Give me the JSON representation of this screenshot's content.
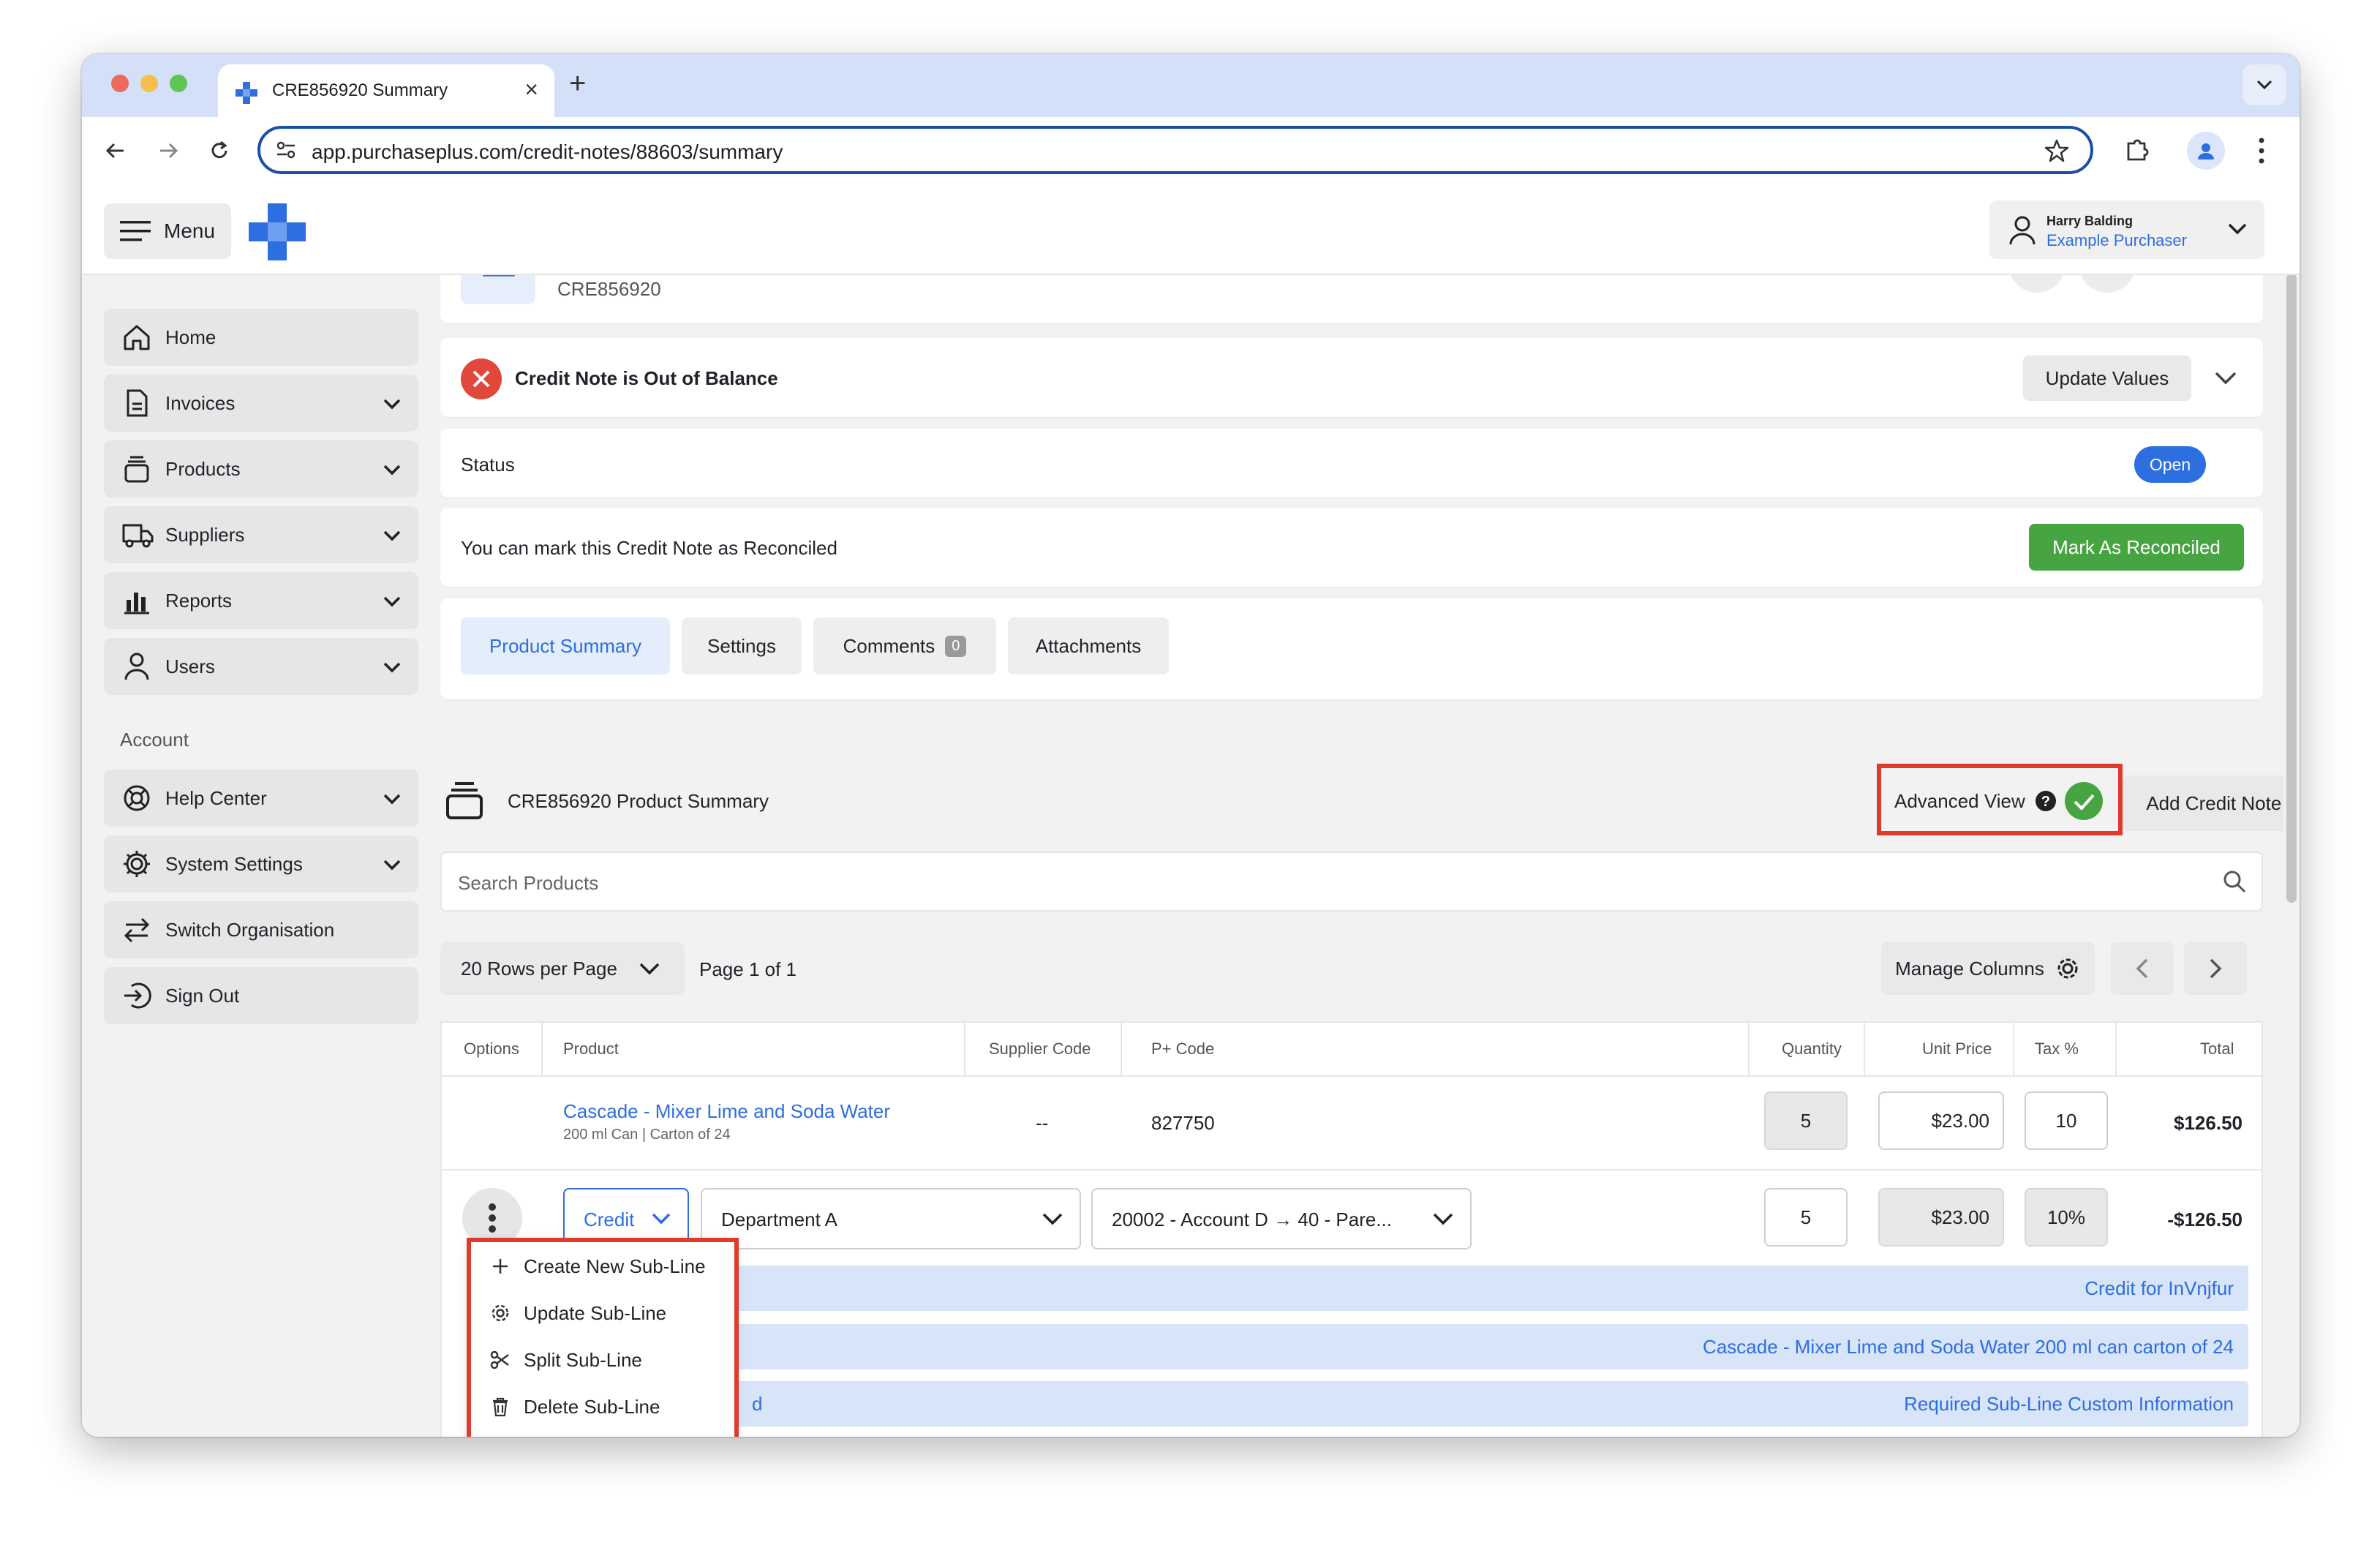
{
  "browser": {
    "tab_title": "CRE856920 Summary",
    "url": "app.purchaseplus.com/credit-notes/88603/summary"
  },
  "topbar": {
    "menu_label": "Menu",
    "user_name": "Harry Balding",
    "user_role": "Example Purchaser"
  },
  "sidebar": {
    "items": [
      {
        "label": "Home",
        "icon": "home-icon"
      },
      {
        "label": "Invoices",
        "icon": "invoice-icon"
      },
      {
        "label": "Products",
        "icon": "products-icon"
      },
      {
        "label": "Suppliers",
        "icon": "truck-icon"
      },
      {
        "label": "Reports",
        "icon": "bar-chart-icon"
      },
      {
        "label": "Users",
        "icon": "user-icon"
      }
    ],
    "account_heading": "Account",
    "account_items": [
      {
        "label": "Help Center",
        "icon": "lifebuoy-icon"
      },
      {
        "label": "System Settings",
        "icon": "gear-icon"
      },
      {
        "label": "Switch Organisation",
        "icon": "switch-icon"
      },
      {
        "label": "Sign Out",
        "icon": "sign-out-icon"
      }
    ]
  },
  "header_card": {
    "reference": "CRE856920"
  },
  "balance": {
    "message": "Credit Note is Out of Balance",
    "update_label": "Update Values"
  },
  "status": {
    "label": "Status",
    "value": "Open"
  },
  "reconcile": {
    "message": "You can mark this Credit Note as Reconciled",
    "button": "Mark As Reconciled"
  },
  "tabs": {
    "product_summary": "Product Summary",
    "settings": "Settings",
    "comments": "Comments",
    "comments_count": "0",
    "attachments": "Attachments"
  },
  "summary": {
    "title": "CRE856920 Product Summary",
    "advanced_view": "Advanced View",
    "add_line": "Add Credit Note Line",
    "search_placeholder": "Search Products",
    "rows_per_page": "20 Rows per Page",
    "page_info": "Page 1 of 1",
    "manage_columns": "Manage Columns"
  },
  "table": {
    "headers": {
      "options": "Options",
      "product": "Product",
      "supplier_code": "Supplier Code",
      "p_code": "P+ Code",
      "quantity": "Quantity",
      "unit_price": "Unit Price",
      "tax": "Tax %",
      "total": "Total"
    },
    "row": {
      "product_name": "Cascade - Mixer Lime and Soda Water",
      "product_detail": "200 ml Can | Carton of 24",
      "supplier_code": "--",
      "p_code": "827750",
      "quantity": "5",
      "unit_price": "$23.00",
      "tax": "10",
      "total": "$126.50"
    },
    "subline": {
      "type": "Credit",
      "department": "Department A",
      "account": "20002 - Account D → 40 - Pare...",
      "quantity": "5",
      "unit_price": "$23.00",
      "tax": "10%",
      "total": "-$126.50",
      "info_1": "Credit for InVnjfur",
      "info_2": "Cascade - Mixer Lime and Soda Water 200 ml can carton of 24",
      "info_3": "Required Sub-Line Custom Information",
      "info_3_fragment": "d"
    }
  },
  "options_menu": {
    "create": "Create New Sub-Line",
    "update": "Update Sub-Line",
    "split": "Split Sub-Line",
    "delete": "Delete Sub-Line"
  },
  "colors": {
    "accent_blue": "#2d6ee0",
    "success_green": "#46a540",
    "error_red": "#e2473b",
    "highlight_red": "#e03a2c"
  }
}
